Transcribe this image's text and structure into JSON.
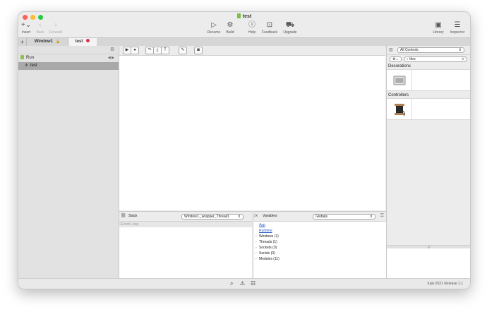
{
  "window": {
    "title": "test"
  },
  "toolbar": {
    "insert": "Insert",
    "back": "Back",
    "forward": "Forward",
    "resume": "Resume",
    "build": "Build",
    "help": "Help",
    "feedback": "Feedback",
    "upgrade": "Upgrade",
    "library": "Library",
    "inspector": "Inspector"
  },
  "tabs": {
    "add": "+",
    "window1": "Window1",
    "test": "test"
  },
  "navigator": {
    "run": "Run",
    "thread": "test"
  },
  "library": {
    "filter": "All Controls",
    "search_value": "thre",
    "decorations_label": "Decorations",
    "controllers_label": "Controllers"
  },
  "stack": {
    "label": "Stack",
    "selector": "Window1._wrapper_Thread1",
    "rows": [
      "Event Loop"
    ]
  },
  "variables": {
    "label": "Variables",
    "selector": "Globals",
    "links": [
      "App",
      "Runtime"
    ],
    "groups": [
      "Windows (1)",
      "Threads (1)",
      "Sockets (0)",
      "Serials (0)",
      "Modules (11)"
    ]
  },
  "status": {
    "version": "Xojo 2021 Release 1.1"
  },
  "colors": {
    "close": "#fe5f57",
    "minimize": "#febc2e",
    "zoom": "#28c840",
    "link": "#2a5dc9",
    "run_icon": "#8bc34a"
  }
}
